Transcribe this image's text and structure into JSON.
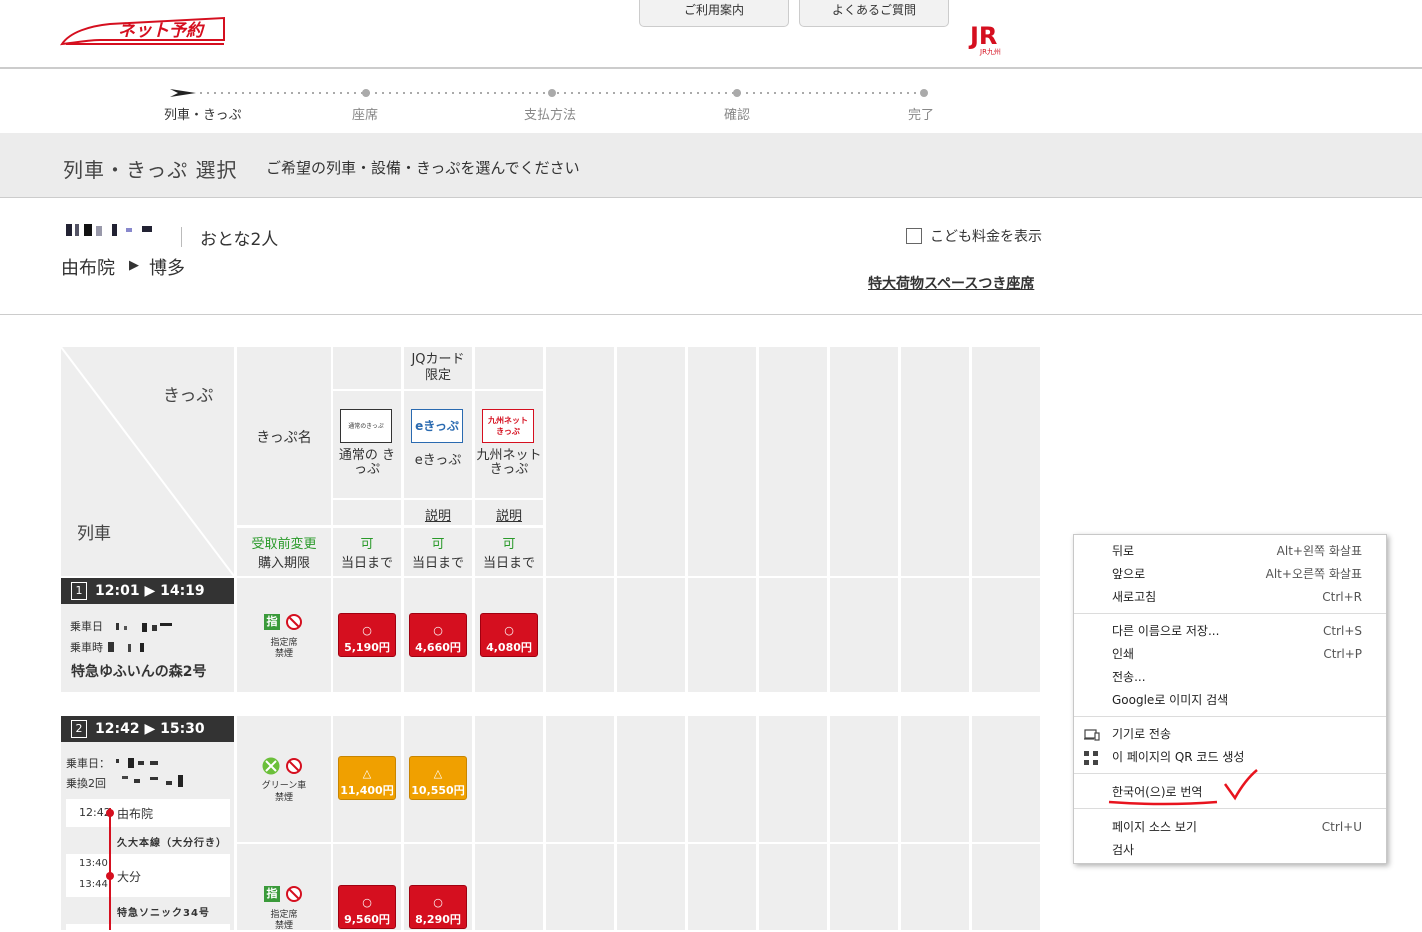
{
  "header": {
    "logo_text": "ネット予約",
    "tab_guide": "ご利用案内",
    "tab_faq": "よくあるご質問",
    "jr_logo": "JR",
    "jr_sub": "JR九州"
  },
  "steps": [
    "列車・きっぷ",
    "座席",
    "支払方法",
    "確認",
    "完了"
  ],
  "titleband": {
    "title": "列車・きっぷ 選択",
    "subtitle": "ご希望の列車・設備・きっぷを選んでください"
  },
  "info": {
    "passengers": "おとな2人",
    "from": "由布院",
    "arrow": "▶",
    "to": "博多",
    "child_fare_label": "こども料金を表示",
    "luggage_link": "特大荷物スペースつき座席"
  },
  "table": {
    "corner_ticket": "きっぷ",
    "corner_train": "列車",
    "ticket_name_label": "きっぷ名",
    "jq_card_limited": "JQカード 限定",
    "change_label": "受取前変更",
    "deadline_label": "購入期限",
    "tickets": [
      {
        "icon_text": "通常のきっぷ",
        "name": "通常の きっぷ",
        "desc": "",
        "change": "可",
        "deadline": "当日まで"
      },
      {
        "icon_text": "eきっぷ",
        "name": "eきっぷ",
        "desc": "説明",
        "change": "可",
        "deadline": "当日まで"
      },
      {
        "icon_text": "九州ネット きっぷ",
        "name": "九州ネット きっぷ",
        "desc": "説明",
        "change": "可",
        "deadline": "当日まで"
      }
    ],
    "trains": [
      {
        "num": "1",
        "depart": "12:01",
        "arrive": "14:19",
        "ride_day_label": "乗車日",
        "ride_time_label": "乗車時",
        "name": "特急ゆふいんの森2号",
        "seat_badge": "指",
        "seat_type": "指定席",
        "smoking": "禁煙",
        "prices": [
          {
            "mark": "○",
            "price": "5,190円"
          },
          {
            "mark": "○",
            "price": "4,660円"
          },
          {
            "mark": "○",
            "price": "4,080円"
          }
        ]
      },
      {
        "num": "2",
        "depart": "12:42",
        "arrive": "15:30",
        "ride_day_label": "乗車日：",
        "transfer_label": "乗換2回",
        "segments": [
          {
            "time": "12:42",
            "station": "由布院"
          },
          {
            "line": "久大本線（大分行き）"
          },
          {
            "time_arr": "13:40",
            "time_dep": "13:44",
            "station": "大分"
          },
          {
            "line": "特急ソニック34号"
          }
        ],
        "rows": [
          {
            "seat_type": "グリーン車",
            "smoking": "禁煙",
            "prices": [
              {
                "mark": "△",
                "price": "11,400円"
              },
              {
                "mark": "△",
                "price": "10,550円"
              }
            ]
          },
          {
            "seat_badge": "指",
            "seat_type": "指定席",
            "smoking": "禁煙",
            "prices": [
              {
                "mark": "○",
                "price": "9,560円"
              },
              {
                "mark": "○",
                "price": "8,290円"
              }
            ]
          }
        ]
      }
    ]
  },
  "context_menu": {
    "items": [
      {
        "label": "뒤로",
        "shortcut": "Alt+왼쪽 화살표"
      },
      {
        "label": "앞으로",
        "shortcut": "Alt+오른쪽 화살표"
      },
      {
        "label": "새로고침",
        "shortcut": "Ctrl+R"
      },
      {
        "label": "다른 이름으로 저장...",
        "shortcut": "Ctrl+S"
      },
      {
        "label": "인쇄",
        "shortcut": "Ctrl+P"
      },
      {
        "label": "전송...",
        "shortcut": ""
      },
      {
        "label": "Google로 이미지 검색",
        "shortcut": ""
      },
      {
        "label": "기기로 전송",
        "shortcut": ""
      },
      {
        "label": "이 페이지의 QR 코드 생성",
        "shortcut": ""
      },
      {
        "label": "한국어(으)로 번역",
        "shortcut": ""
      },
      {
        "label": "페이지 소스 보기",
        "shortcut": "Ctrl+U"
      },
      {
        "label": "검사",
        "shortcut": ""
      }
    ]
  },
  "colors": {
    "brand_red": "#d50f1f",
    "available_orange": "#f0a000",
    "change_green": "#2a9a2a",
    "annotation_red": "#e8141e"
  }
}
